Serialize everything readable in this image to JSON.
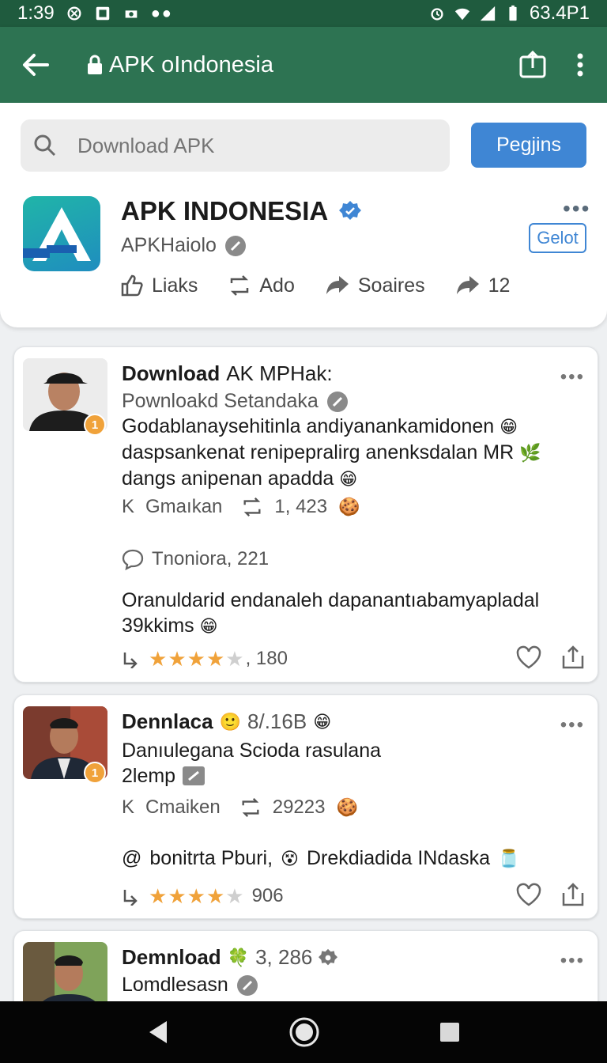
{
  "status_bar": {
    "time": "1:39",
    "right_text": "63.4P1"
  },
  "app_bar": {
    "title": "APK oIndonesia"
  },
  "search": {
    "placeholder": "Download APK",
    "button_label": "Pegjins"
  },
  "app": {
    "name": "APK INDONESIA",
    "handle": "APKHaiolo",
    "get_label": "Gelot",
    "stats": {
      "likes_label": "Liaks",
      "add_label": "Ado",
      "shares_label": "Soaires",
      "share_count": "12"
    }
  },
  "posts": [
    {
      "badge": "1",
      "title_bold": "Download",
      "title_rest": "AK MPHak:",
      "subtitle": "Pownloakd Setandaka",
      "body_lines": [
        "Godablanaysehitinla andiyanankamidonen",
        "daspsankenat renipepralirg anenksdalan MR",
        "dangs anipenan apadda"
      ],
      "comment_label": "Gmaıkan",
      "repost_count": "1, 423",
      "reply_text": "Tnoniora, 221",
      "second_body": [
        "Oranuldarid endanaleh dapanantıabamyapladal",
        "39kkims"
      ],
      "rating": 3.5,
      "rating_count": ", 180",
      "letter": "K"
    },
    {
      "badge": "1",
      "title_bold": "Dennlaca",
      "title_rest": "8/.16B",
      "body_lines": [
        "Danıulegana Scioda rasulana",
        "2lemp"
      ],
      "comment_label": "Cmaiken",
      "repost_count": "29223",
      "mention_text": "bonitrta Pburi,",
      "mention_rest": "Drekdiadida INdaska",
      "rating": 3.5,
      "rating_count": "906",
      "letter": "K"
    },
    {
      "title_bold": "Demnload",
      "title_rest": "3, 286",
      "subtitle": "Lomdlesasn"
    }
  ]
}
